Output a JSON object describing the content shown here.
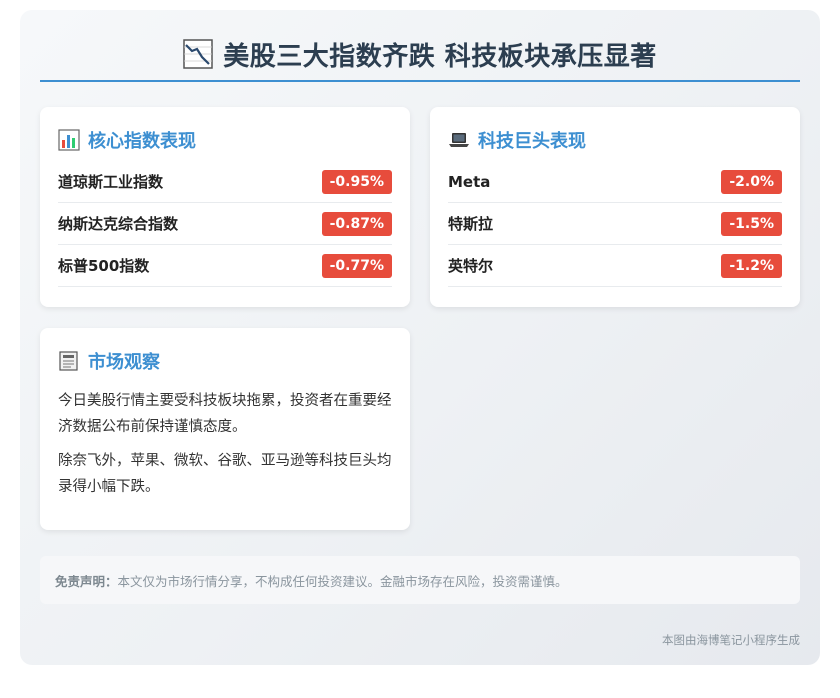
{
  "title": "美股三大指数齐跌 科技板块承压显著",
  "indices_card": {
    "heading": "核心指数表现",
    "rows": [
      {
        "name": "道琼斯工业指数",
        "change": "-0.95%"
      },
      {
        "name": "纳斯达克综合指数",
        "change": "-0.87%"
      },
      {
        "name": "标普500指数",
        "change": "-0.77%"
      }
    ]
  },
  "tech_card": {
    "heading": "科技巨头表现",
    "rows": [
      {
        "name": "Meta",
        "change": "-2.0%"
      },
      {
        "name": "特斯拉",
        "change": "-1.5%"
      },
      {
        "name": "英特尔",
        "change": "-1.2%"
      }
    ]
  },
  "market_card": {
    "heading": "市场观察",
    "paragraphs": [
      "今日美股行情主要受科技板块拖累，投资者在重要经济数据公布前保持谨慎态度。",
      "除奈飞外，苹果、微软、谷歌、亚马逊等科技巨头均录得小幅下跌。"
    ]
  },
  "disclaimer": {
    "label": "免责声明：",
    "text": "本文仅为市场行情分享，不构成任何投资建议。金融市场存在风险，投资需谨慎。"
  },
  "footer": "本图由海博笔记小程序生成",
  "colors": {
    "accent": "#3d8fd1",
    "negative": "#e74c3c",
    "title": "#2c3e50"
  },
  "icons": {
    "title": "chart-decreasing-icon",
    "indices": "bar-chart-icon",
    "tech": "laptop-icon",
    "market": "newspaper-icon"
  }
}
